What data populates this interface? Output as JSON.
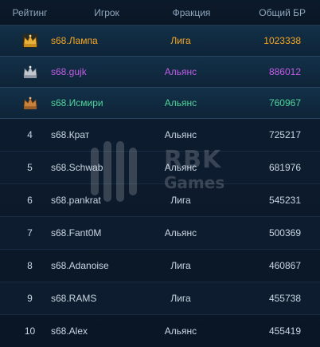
{
  "header": {
    "rank": "Рейтинг",
    "player": "Игрок",
    "faction": "Фракция",
    "score": "Общий БР"
  },
  "rows": [
    {
      "rank": "",
      "icon": "gold-crown-icon",
      "name": "s68.Лампа",
      "faction": "Лига",
      "score": "1023338",
      "color": "#f5a623"
    },
    {
      "rank": "",
      "icon": "silver-crown-icon",
      "name": "s68.gujk",
      "faction": "Альянс",
      "score": "886012",
      "color": "#c45ce8"
    },
    {
      "rank": "",
      "icon": "bronze-crown-icon",
      "name": "s68.Исмири",
      "faction": "Альянс",
      "score": "760967",
      "color": "#4fd49a"
    },
    {
      "rank": "4",
      "name": "s68.Крат",
      "faction": "Альянс",
      "score": "725217"
    },
    {
      "rank": "5",
      "name": "s68.Schwab",
      "faction": "Альянс",
      "score": "681976"
    },
    {
      "rank": "6",
      "name": "s68.pankrat",
      "faction": "Лига",
      "score": "545231"
    },
    {
      "rank": "7",
      "name": "s68.Fant0M",
      "faction": "Альянс",
      "score": "500369"
    },
    {
      "rank": "8",
      "name": "s68.Adanoise",
      "faction": "Лига",
      "score": "460867"
    },
    {
      "rank": "9",
      "name": "s68.RAMS",
      "faction": "Лига",
      "score": "455738"
    },
    {
      "rank": "10",
      "name": "s68.Alex",
      "faction": "Альянс",
      "score": "455419"
    }
  ],
  "watermark": {
    "line1": "RBK",
    "line2": "Games"
  },
  "colors": {
    "gold": "#e8b13a",
    "silver": "#c2c8d0",
    "bronze": "#c9823c"
  }
}
